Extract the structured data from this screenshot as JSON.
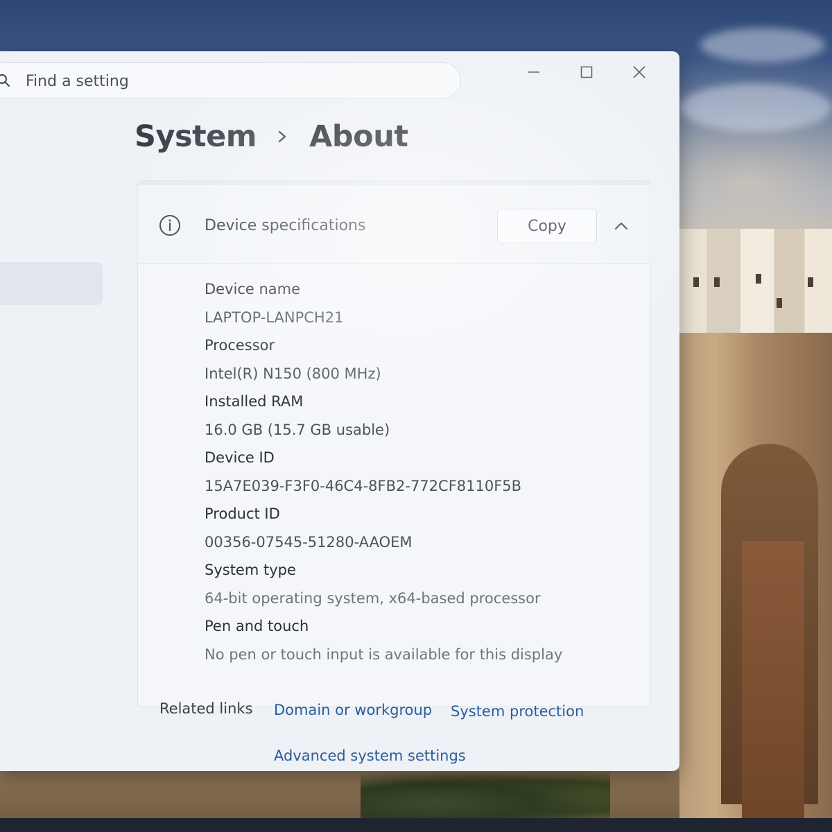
{
  "search": {
    "placeholder": "Find a setting"
  },
  "breadcrumb": {
    "parent": "System",
    "current": "About"
  },
  "device_specs": {
    "title": "Device specifications",
    "copy_label": "Copy",
    "items": [
      {
        "label": "Device name",
        "value": "LAPTOP-LANPCH21"
      },
      {
        "label": "Processor",
        "value": "Intel(R) N150 (800 MHz)"
      },
      {
        "label": "Installed RAM",
        "value": "16.0 GB (15.7 GB usable)"
      },
      {
        "label": "Device ID",
        "value": "15A7E039-F3F0-46C4-8FB2-772CF8110F5B"
      },
      {
        "label": "Product ID",
        "value": "00356-07545-51280-AAOEM"
      },
      {
        "label": "System type",
        "value": "64-bit operating system, x64-based processor"
      },
      {
        "label": "Pen and touch",
        "value": "No pen or touch input is available for this display"
      }
    ]
  },
  "related_links": {
    "label": "Related links",
    "links": [
      "Domain or workgroup",
      "System protection",
      "Advanced system settings"
    ]
  },
  "icons": {
    "search": "search-icon",
    "minimize": "minimize-icon",
    "maximize": "maximize-icon",
    "close": "close-icon",
    "breadcrumb_separator": "chevron-right-icon",
    "info": "info-icon",
    "collapse": "chevron-up-icon"
  },
  "colors": {
    "window_bg": "#eef1f6",
    "card_bg": "#f4f6fa",
    "link": "#2a5e98",
    "text_primary": "#2c3037"
  }
}
